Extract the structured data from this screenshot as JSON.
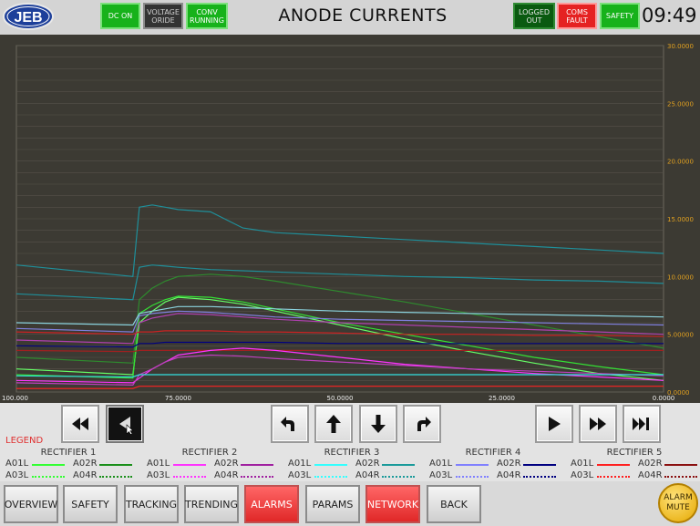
{
  "header": {
    "logo_text": "JEB",
    "title": "ANODE CURRENTS",
    "clock": "09:49",
    "indicators": [
      {
        "label": "DC ON",
        "color": "#17b21b"
      },
      {
        "label": "VOLTAGE\nORIDE",
        "color": "#333333"
      },
      {
        "label": "CONV\nRUNNING",
        "color": "#17b21b"
      },
      {
        "label": "LOGGED\nOUT",
        "color": "#0a5a10"
      },
      {
        "label": "COMS\nFAULT",
        "color": "#e52222"
      },
      {
        "label": "SAFETY",
        "color": "#17b21b"
      }
    ]
  },
  "chart_data": {
    "type": "line",
    "background": "#3c3a33",
    "grid": true,
    "x_ticks": [
      "100.000",
      "75.0000",
      "50.0000",
      "25.0000",
      "0.0000"
    ],
    "xlim": [
      100,
      0
    ],
    "y_ticks": [
      "0.0000",
      "5.00000",
      "10.0000",
      "15.0000",
      "20.0000",
      "25.0000",
      "30.0000"
    ],
    "ylim": [
      0,
      30
    ],
    "x": [
      100,
      82,
      81,
      79,
      77,
      75,
      70,
      65,
      60,
      50,
      40,
      30,
      20,
      10,
      0
    ],
    "series": [
      {
        "color": "#1f8f9a",
        "values": [
          11.0,
          10.0,
          16.0,
          16.2,
          16.0,
          15.8,
          15.6,
          14.2,
          13.8,
          13.5,
          13.2,
          12.9,
          12.6,
          12.3,
          12.0
        ]
      },
      {
        "color": "#1f8f9a",
        "values": [
          8.5,
          8.0,
          10.8,
          11.0,
          10.9,
          10.8,
          10.6,
          10.5,
          10.4,
          10.2,
          10.0,
          9.9,
          9.7,
          9.6,
          9.4
        ]
      },
      {
        "color": "#2e8b2e",
        "values": [
          3.0,
          2.5,
          8.0,
          9.0,
          9.6,
          10.0,
          10.2,
          10.0,
          9.6,
          8.7,
          7.8,
          6.8,
          5.8,
          4.8,
          3.8
        ]
      },
      {
        "color": "#66ff66",
        "values": [
          2.0,
          1.5,
          6.0,
          7.0,
          7.8,
          8.2,
          8.0,
          7.6,
          7.0,
          5.8,
          4.6,
          3.5,
          2.5,
          1.6,
          1.0
        ]
      },
      {
        "color": "#34e034",
        "values": [
          1.5,
          1.2,
          6.8,
          7.5,
          8.0,
          8.3,
          8.2,
          7.8,
          7.2,
          6.0,
          5.0,
          4.0,
          3.0,
          2.2,
          1.5
        ]
      },
      {
        "color": "#8bd3de",
        "values": [
          6.0,
          5.8,
          6.8,
          7.0,
          7.2,
          7.4,
          7.4,
          7.3,
          7.2,
          7.0,
          6.9,
          6.8,
          6.7,
          6.6,
          6.5
        ]
      },
      {
        "color": "#8080e0",
        "values": [
          5.5,
          5.2,
          6.6,
          6.8,
          6.9,
          7.0,
          6.9,
          6.7,
          6.5,
          6.3,
          6.2,
          6.1,
          6.0,
          5.9,
          5.8
        ]
      },
      {
        "color": "#b040b0",
        "values": [
          4.5,
          4.2,
          6.0,
          6.4,
          6.6,
          6.8,
          6.7,
          6.5,
          6.3,
          6.0,
          5.8,
          5.6,
          5.4,
          5.2,
          5.0
        ]
      },
      {
        "color": "#cc2222",
        "values": [
          5.2,
          5.0,
          5.2,
          5.2,
          5.3,
          5.3,
          5.3,
          5.2,
          5.2,
          5.1,
          5.0,
          5.0,
          4.9,
          4.9,
          4.8
        ]
      },
      {
        "color": "#000080",
        "values": [
          4.0,
          3.9,
          4.2,
          4.2,
          4.3,
          4.3,
          4.3,
          4.3,
          4.3,
          4.2,
          4.2,
          4.2,
          4.2,
          4.2,
          4.2
        ]
      },
      {
        "color": "#a02020",
        "values": [
          3.6,
          3.5,
          3.6,
          3.6,
          3.6,
          3.6,
          3.6,
          3.6,
          3.6,
          3.6,
          3.6,
          3.6,
          3.6,
          3.6,
          3.6
        ]
      },
      {
        "color": "#ff33ff",
        "values": [
          1.0,
          0.8,
          1.2,
          2.0,
          2.6,
          3.2,
          3.6,
          3.8,
          3.6,
          3.0,
          2.4,
          2.0,
          1.6,
          1.3,
          1.0
        ]
      },
      {
        "color": "#c040c0",
        "values": [
          0.8,
          0.6,
          1.5,
          2.0,
          2.6,
          3.0,
          3.2,
          3.1,
          2.9,
          2.6,
          2.3,
          2.0,
          1.8,
          1.6,
          1.4
        ]
      },
      {
        "color": "#33e0e0",
        "values": [
          1.4,
          1.3,
          1.5,
          1.5,
          1.5,
          1.5,
          1.5,
          1.5,
          1.5,
          1.5,
          1.5,
          1.5,
          1.5,
          1.5,
          1.5
        ]
      },
      {
        "color": "#ff2222",
        "values": [
          0.3,
          0.3,
          0.5,
          0.5,
          0.5,
          0.5,
          0.5,
          0.5,
          0.5,
          0.5,
          0.5,
          0.5,
          0.5,
          0.5,
          0.5
        ]
      }
    ]
  },
  "nav": {
    "buttons": [
      "rewind-fast",
      "rewind",
      "undo",
      "up",
      "down",
      "redo",
      "play",
      "fast-forward",
      "skip-end"
    ]
  },
  "legend": {
    "title": "LEGEND",
    "rectifiers": [
      {
        "name": "RECTIFIER 1",
        "a01l": "A01L",
        "a02r": "A02R",
        "a03l": "A03L",
        "a04r": "A04R",
        "c1": "#33ff33",
        "c2": "#1a8f1a",
        "c3": "#33ff33",
        "c4": "#1a8f1a"
      },
      {
        "name": "RECTIFIER 2",
        "a01l": "A01L",
        "a02r": "A02R",
        "a03l": "A03L",
        "a04r": "A04R",
        "c1": "#ff33ff",
        "c2": "#a020a0",
        "c3": "#ff33ff",
        "c4": "#a020a0"
      },
      {
        "name": "RECTIFIER 3",
        "a01l": "A01L",
        "a02r": "A02R",
        "a03l": "A03L",
        "a04r": "A04R",
        "c1": "#33ffff",
        "c2": "#1a9a9a",
        "c3": "#33ffff",
        "c4": "#1a9a9a"
      },
      {
        "name": "RECTIFIER 4",
        "a01l": "A01L",
        "a02r": "A02R",
        "a03l": "A03L",
        "a04r": "A04R",
        "c1": "#8080ff",
        "c2": "#000080",
        "c3": "#8080ff",
        "c4": "#000080"
      },
      {
        "name": "RECTIFIER 5",
        "a01l": "A01L",
        "a02r": "A02R",
        "a03l": "A03L",
        "a04r": "A04R",
        "c1": "#ff2020",
        "c2": "#8a1010",
        "c3": "#ff2020",
        "c4": "#8a1010"
      }
    ]
  },
  "bottom_nav": {
    "overview": "OVERVIEW",
    "safety": "SAFETY",
    "tracking": "TRACKING",
    "trending": "TRENDING",
    "alarms": "ALARMS",
    "params": "PARAMS",
    "network": "NETWORK",
    "back": "BACK",
    "alarm_mute": "ALARM\nMUTE"
  }
}
